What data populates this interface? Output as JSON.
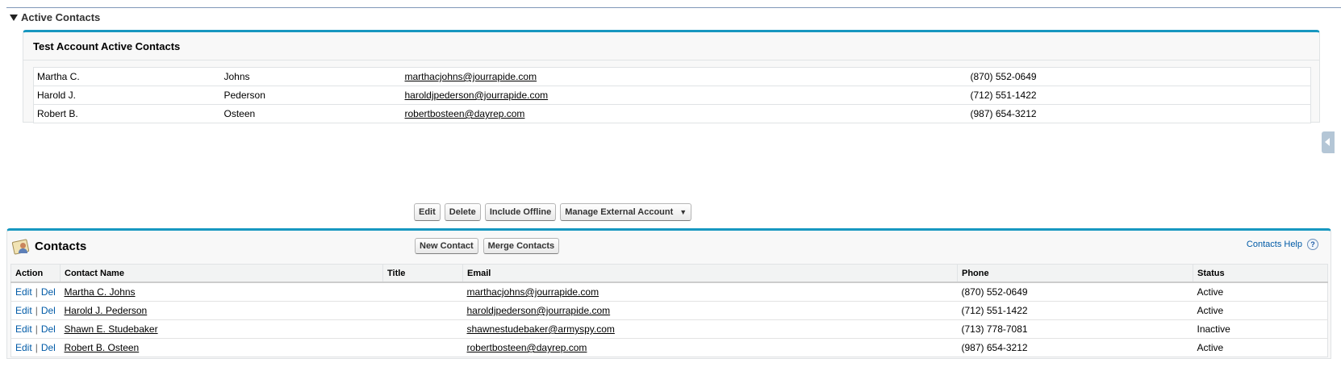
{
  "section": {
    "title": "Active Contacts"
  },
  "active_panel": {
    "title": "Test Account Active Contacts",
    "rows": [
      {
        "first": "Martha C.",
        "last": "Johns",
        "email": "marthacjohns@jourrapide.com",
        "phone": "(870) 552-0649"
      },
      {
        "first": "Harold J.",
        "last": "Pederson",
        "email": "haroldjpederson@jourrapide.com",
        "phone": "(712) 551-1422"
      },
      {
        "first": "Robert B.",
        "last": "Osteen",
        "email": "robertbosteen@dayrep.com",
        "phone": "(987) 654-3212"
      }
    ]
  },
  "toolbar": {
    "edit": "Edit",
    "delete": "Delete",
    "include_offline": "Include Offline",
    "manage_external": "Manage External Account",
    "manage_caret": "▼"
  },
  "contacts": {
    "title": "Contacts",
    "new_contact": "New Contact",
    "merge_contacts": "Merge Contacts",
    "help_label": "Contacts Help",
    "help_icon": "?",
    "columns": {
      "action": "Action",
      "name": "Contact Name",
      "title": "Title",
      "email": "Email",
      "phone": "Phone",
      "status": "Status"
    },
    "edit_label": "Edit",
    "del_label": "Del",
    "separator": "|",
    "rows": [
      {
        "name": "Martha C. Johns",
        "title": "",
        "email": "marthacjohns@jourrapide.com",
        "phone": "(870) 552-0649",
        "status": "Active"
      },
      {
        "name": "Harold J. Pederson",
        "title": "",
        "email": "haroldjpederson@jourrapide.com",
        "phone": "(712) 551-1422",
        "status": "Active"
      },
      {
        "name": "Shawn E. Studebaker",
        "title": "",
        "email": "shawnestudebaker@armyspy.com",
        "phone": "(713) 778-7081",
        "status": "Inactive"
      },
      {
        "name": "Robert B. Osteen",
        "title": "",
        "email": "robertbosteen@dayrep.com",
        "phone": "(987) 654-3212",
        "status": "Active"
      }
    ]
  },
  "colors": {
    "accent": "#1797c0",
    "link": "#015ba7",
    "header_bg": "#f2f3f3",
    "panel_bg": "#f8f8f8"
  }
}
